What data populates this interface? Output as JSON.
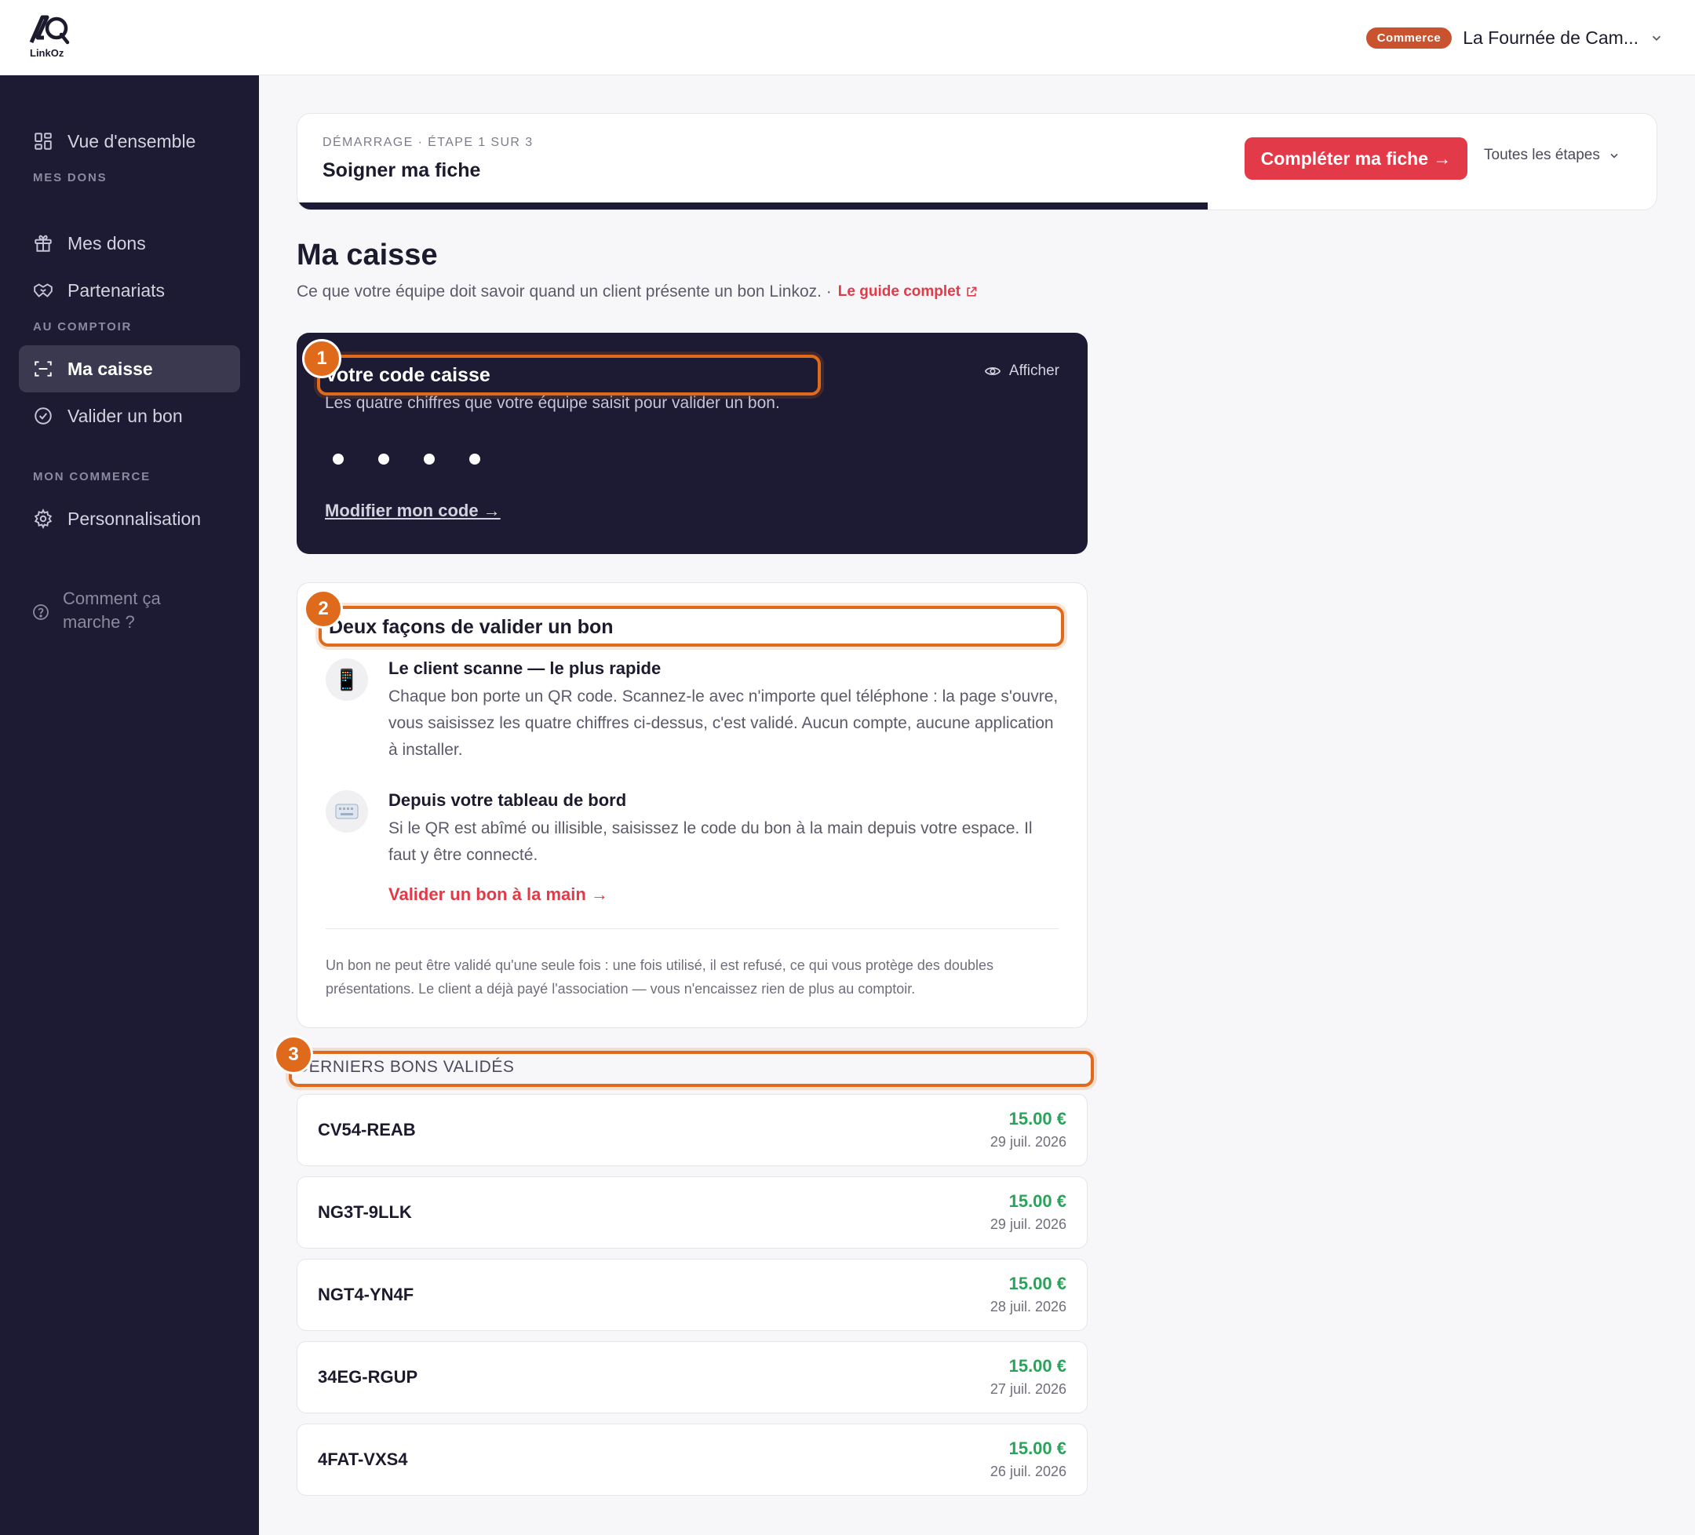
{
  "header": {
    "logo_text": "LinkOz",
    "merchant_badge": "Commerce",
    "merchant_name": "La Fournée de Cam..."
  },
  "sidebar": {
    "overview": "Vue d'ensemble",
    "section_dons": "MES DONS",
    "mes_dons": "Mes dons",
    "partenariats": "Partenariats",
    "section_comptoir": "AU COMPTOIR",
    "ma_caisse": "Ma caisse",
    "valider_bon": "Valider un bon",
    "section_commerce": "MON COMMERCE",
    "personnalisation": "Personnalisation",
    "help_line1": "Comment ça",
    "help_line2": "marche ?"
  },
  "onboarding": {
    "step": "DÉMARRAGE · ÉTAPE 1 SUR 3",
    "title": "Soigner ma fiche",
    "cta": "Compléter ma fiche →",
    "all_steps": "Toutes les étapes",
    "progress": 0.67
  },
  "page": {
    "title": "Ma caisse",
    "subtitle": "Ce que votre équipe doit savoir quand un client présente un bon Linkoz. ·",
    "guide_link": "Le guide complet"
  },
  "code_card": {
    "title": "Votre code caisse",
    "desc": "Les quatre chiffres que votre équipe saisit pour valider un bon.",
    "show": "Afficher",
    "modify": "Modifier mon code →"
  },
  "ways": {
    "title": "Deux façons de valider un bon",
    "way1_title": "Le client scanne — le plus rapide",
    "way1_desc": "Chaque bon porte un QR code. Scannez-le avec n'importe quel téléphone : la page s'ouvre, vous saisissez les quatre chiffres ci-dessus, c'est validé. Aucun compte, aucune application à installer.",
    "way2_title": "Depuis votre tableau de bord",
    "way2_desc": "Si le QR est abîmé ou illisible, saisissez le code du bon à la main depuis votre espace. Il faut y être connecté.",
    "way2_link": "Valider un bon à la main →",
    "note": "Un bon ne peut être validé qu'une seule fois : une fois utilisé, il est refusé, ce qui vous protège des doubles présentations. Le client a déjà payé l'association — vous n'encaissez rien de plus au comptoir."
  },
  "recent": {
    "title": "DERNIERS BONS VALIDÉS",
    "items": [
      {
        "code": "CV54-REAB",
        "amount": "15.00 €",
        "date": "29 juil. 2026"
      },
      {
        "code": "NG3T-9LLK",
        "amount": "15.00 €",
        "date": "29 juil. 2026"
      },
      {
        "code": "NGT4-YN4F",
        "amount": "15.00 €",
        "date": "28 juil. 2026"
      },
      {
        "code": "34EG-RGUP",
        "amount": "15.00 €",
        "date": "27 juil. 2026"
      },
      {
        "code": "4FAT-VXS4",
        "amount": "15.00 €",
        "date": "26 juil. 2026"
      }
    ]
  },
  "markers": [
    "1",
    "2",
    "3"
  ],
  "colors": {
    "sidebar": "#1d1b33",
    "accent": "#e23a48",
    "badge": "#c9532e",
    "amount": "#2aa35a",
    "highlight": "#e06a1c"
  }
}
